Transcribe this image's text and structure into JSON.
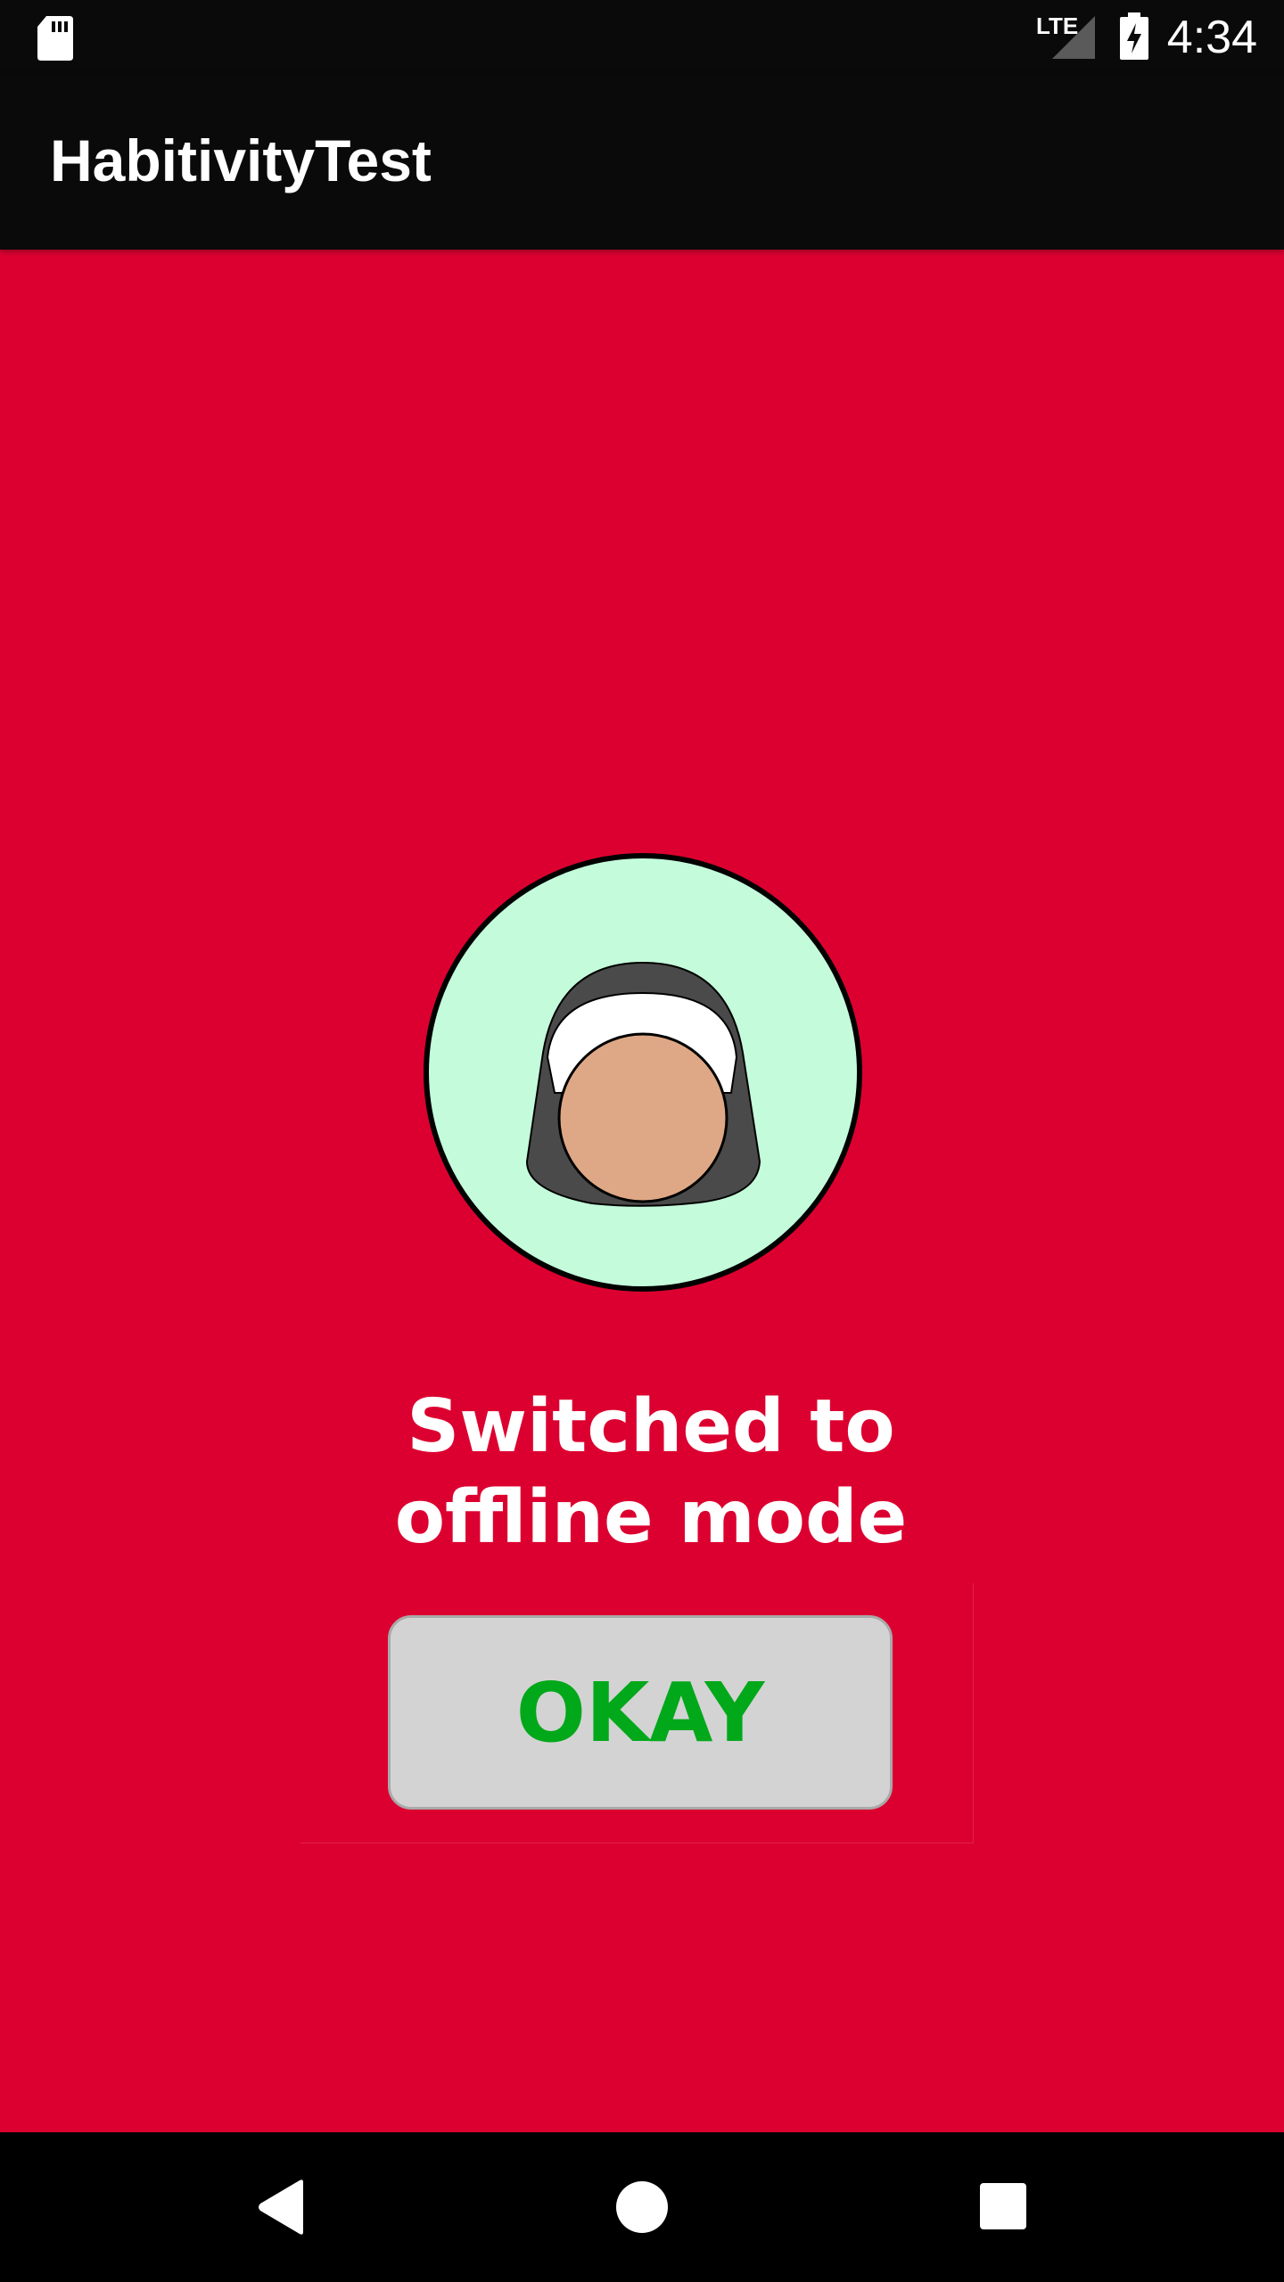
{
  "status_bar": {
    "time": "4:34",
    "network_label": "LTE",
    "icons": [
      "sd-card-icon",
      "signal-icon",
      "battery-charging-icon"
    ]
  },
  "app_bar": {
    "title": "HabitivityTest"
  },
  "main": {
    "avatar_icon": "user-avatar-icon",
    "message": "Switched to offline mode",
    "okay_button_label": "OKAY"
  },
  "nav_bar": {
    "icons": [
      "back-icon",
      "home-icon",
      "recents-icon"
    ]
  },
  "colors": {
    "background": "#DC0030",
    "bars": "#0A0A0B",
    "avatar_circle": "#C4FCDB",
    "button_bg": "#D3D3D3",
    "button_text": "#00A81A"
  }
}
